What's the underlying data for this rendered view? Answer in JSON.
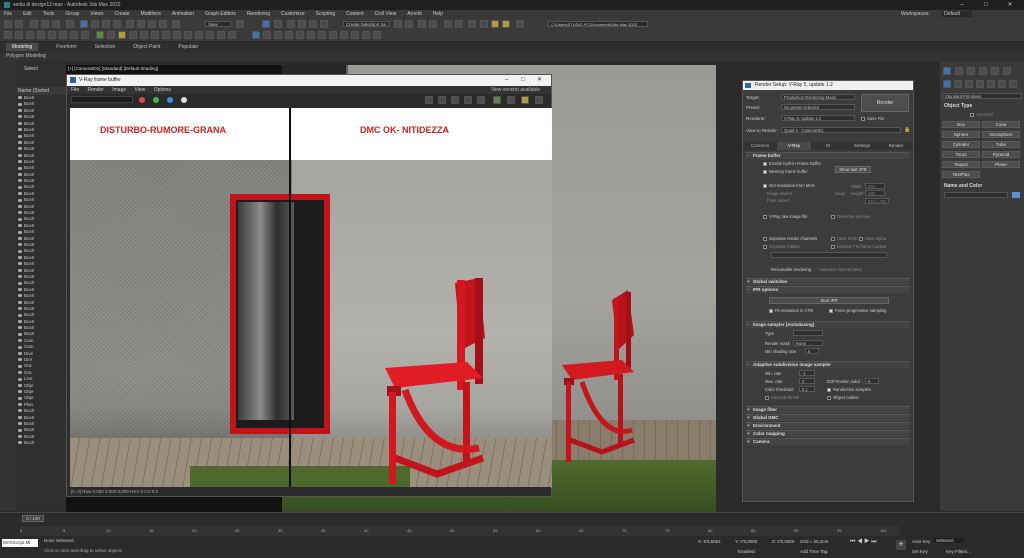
{
  "app": {
    "title": "sedia di design12.max - Autodesk 3ds Max 2022",
    "workspaces_label": "Workspaces:",
    "workspace_value": "Default"
  },
  "menu": [
    "File",
    "Edit",
    "Tools",
    "Group",
    "Views",
    "Create",
    "Modifiers",
    "Animation",
    "Graph Editors",
    "Rendering",
    "Customize",
    "Scripting",
    "Content",
    "Civil View",
    "Arnold",
    "Help"
  ],
  "toolbar": {
    "selection_set": "Create Selection Se",
    "view_dropdown": "View",
    "path": "C:\\Users\\STUDIO PC\\Documents\\3ds Max 2022"
  },
  "ribbon": {
    "tabs": [
      "Modeling",
      "Freeform",
      "Selection",
      "Object Paint",
      "Populate"
    ],
    "sub": "Polygon Modeling"
  },
  "scene_explorer": {
    "select_label": "Select",
    "header": "Name (Sorted",
    "rows": [
      "Box0",
      "Box0",
      "Box0",
      "Box0",
      "Box0",
      "Box0",
      "Box0",
      "Box0",
      "Box0",
      "Box0",
      "Box0",
      "Box0",
      "Box0",
      "Box0",
      "Box0",
      "Box0",
      "Box0",
      "Box0",
      "Box0",
      "Box0",
      "Box0",
      "Box0",
      "Box0",
      "Box0",
      "Box0",
      "Box0",
      "Box0",
      "Box0",
      "Box0",
      "Box0",
      "Box0",
      "Box0",
      "Box0",
      "Box0",
      "Box0",
      "Box0",
      "Box0",
      "Box0",
      "Cam",
      "Cam",
      "Dive",
      "Dire",
      "Gra",
      "Gra",
      "Line",
      "Obje",
      "Obje",
      "Obje",
      "Plan",
      "Box0",
      "Box0",
      "Box0",
      "Box0",
      "Box0",
      "Box0"
    ]
  },
  "viewport": {
    "label": "[+] [Camera001] [Standard] [Default Shading]"
  },
  "vfb": {
    "title": "V-Ray frame buffer",
    "menu": [
      "File",
      "Render",
      "Image",
      "View",
      "Options"
    ],
    "new_version": "New version available",
    "label_left": "DISTURBO-RUMORE-GRANA",
    "label_right": "DMC OK- NITIDEZZA",
    "status": "[0, 0]   Raw   0.000  0.000  0.000   HSV   0   0.0   0.0"
  },
  "render_setup": {
    "title": "Render Setup: V-Ray 5, update 1.2",
    "target_label": "Target:",
    "target_value": "Production Rendering Mode",
    "preset_label": "Preset:",
    "preset_value": "No preset selected",
    "renderer_label": "Renderer:",
    "renderer_value": "V-Ray 5, update 1.2",
    "save_file": "Save File",
    "view_label": "View to Render:",
    "view_value": "Quad 4 - Camera001",
    "render_button": "Render",
    "tabs": [
      "Common",
      "V-Ray",
      "GI",
      "Settings",
      "Render Elements"
    ],
    "frame_buffer": "Frame buffer",
    "enable_vfb": "Enable built-in Frame Buffer",
    "memory_fb": "Memory frame buffer",
    "show_last": "Show last VFB",
    "get_res": "Get resolution from MAX",
    "image_aspect": "Image aspect",
    "pixel_aspect": "Pixel aspect",
    "swap": "Swap",
    "width_label": "Width",
    "width_value": "640",
    "height_label": "Height",
    "height_value": "480",
    "preset_res": "640 x 480",
    "raw_image": "V-Ray raw image file",
    "generate_preview": "Generate preview",
    "separate_channels": "Separate render channels",
    "save_rgb": "Save RGB",
    "save_alpha": "Save alpha",
    "separate_folders": "Separate folders",
    "expand": "Expand # to frame number",
    "resumable": "Resumable rendering",
    "autosave": "Autosave interval (min)",
    "global_switches": "Global switches",
    "ipr": "IPR options",
    "start_ipr": "Start IPR",
    "fit_vfb": "Fit resolution to VFB",
    "force_progressive": "Force progressive sampling",
    "image_sampler": "Image sampler (Antialiasing)",
    "type_label": "Type",
    "render_mask": "Render mask",
    "none": "None",
    "min_shading": "Min shading rate",
    "min_shading_value": "6",
    "adaptive": "Adaptive subdivision image sampler",
    "min_rate": "Min. rate",
    "min_rate_value": "-1",
    "max_rate": "Max. rate",
    "max_rate_value": "2",
    "color_threshold": "Color threshold",
    "color_threshold_value": "0,1",
    "normals_thresh": "Normals thresh",
    "dof_mb": "DOF/motion subd",
    "dof_mb_value": "8",
    "randomize": "Randomize samples",
    "object_outline": "Object outline",
    "image_filter": "Image filter",
    "global_dmc": "Global DMC",
    "environment": "Environment",
    "color_mapping": "Color mapping",
    "camera": "Camera"
  },
  "command_panel": {
    "dropdown": "Standard Primitives",
    "object_type": "Object Type",
    "autogrid": "AutoGrid",
    "buttons": [
      "Box",
      "Cone",
      "Sphere",
      "GeoSphere",
      "Cylinder",
      "Tube",
      "Torus",
      "Pyramid",
      "Teapot",
      "Plane",
      "TextPlus"
    ],
    "name_color": "Name and Color"
  },
  "timeline": {
    "frame": "0 / 100",
    "ticks": [
      "0",
      "5",
      "10",
      "15",
      "20",
      "25",
      "30",
      "35",
      "40",
      "45",
      "50",
      "55",
      "60",
      "65",
      "70",
      "75",
      "80",
      "85",
      "90",
      "95",
      "100"
    ]
  },
  "status": {
    "script": "MAXScript Mi",
    "msg1": "None Selected",
    "msg2": "Click or click-and-drag to select objects",
    "x": "X: 9'0,5054",
    "y": "Y: 0'0,0000",
    "z": "Z: 0'0,0000",
    "grid": "Grid = 25,4cm",
    "add_time_tag": "Add Time Tag",
    "auto_key": "Auto Key",
    "selected": "Selected",
    "set_key": "Set Key",
    "key_filters": "Key Filters...",
    "enabled": "Enabled:"
  }
}
